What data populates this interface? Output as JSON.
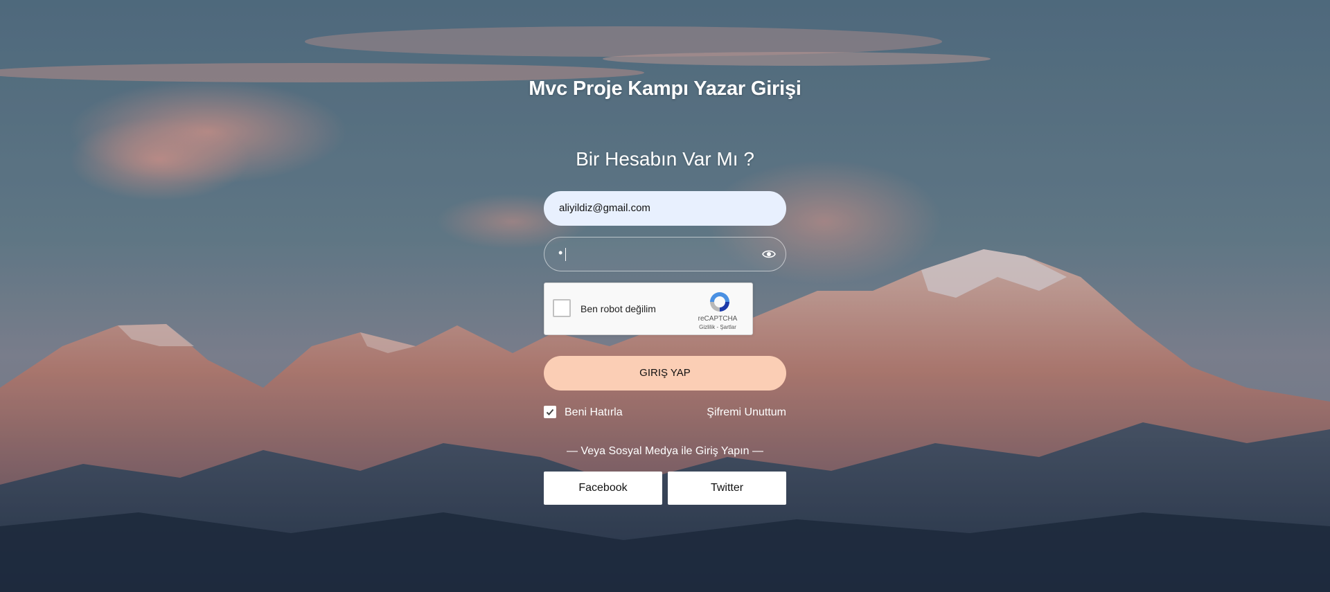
{
  "header": {
    "title": "Mvc Proje Kampı Yazar Girişi",
    "subtitle": "Bir Hesabın Var Mı ?"
  },
  "form": {
    "email_value": "aliyildiz@gmail.com",
    "password_mask": "•",
    "show_password_icon": "eye-icon"
  },
  "captcha": {
    "label": "Ben robot değilim",
    "brand": "reCAPTCHA",
    "links": "Gizlilik - Şartlar",
    "checked": false
  },
  "actions": {
    "login_label": "GIRIŞ YAP",
    "remember_label": "Beni Hatırla",
    "remember_checked": true,
    "forgot_label": "Şifremi Unuttum"
  },
  "social": {
    "divider_text": "— Veya Sosyal Medya ile Giriş Yapın —",
    "facebook_label": "Facebook",
    "twitter_label": "Twitter"
  },
  "colors": {
    "login_button": "#fbceb5",
    "email_field_bg": "#e8f0fe",
    "text_light": "#ffffff"
  }
}
